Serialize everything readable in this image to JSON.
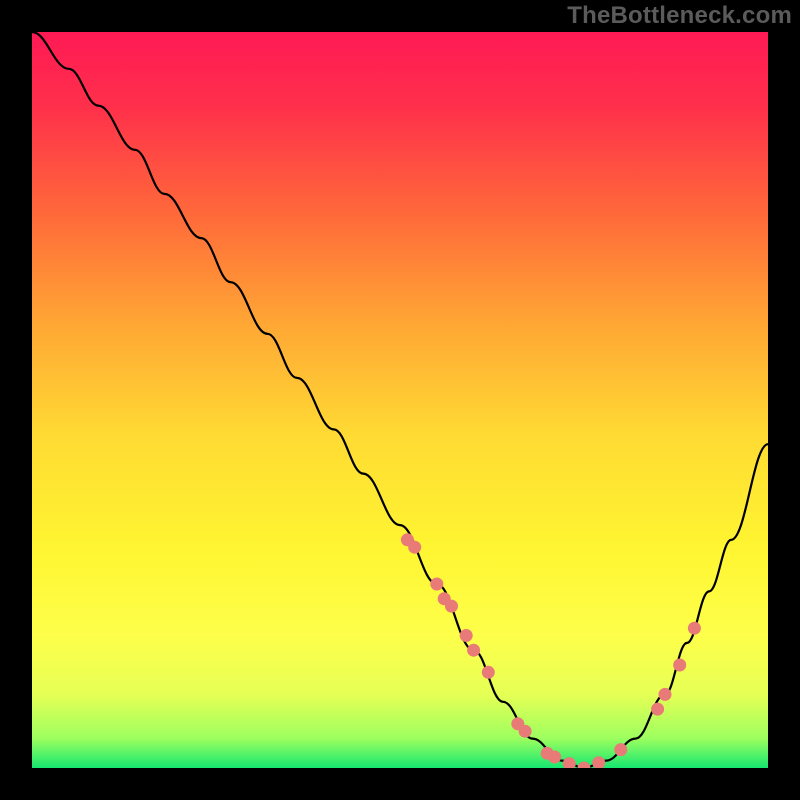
{
  "watermark": "TheBottleneck.com",
  "chart_data": {
    "type": "line",
    "title": "",
    "xlabel": "",
    "ylabel": "",
    "xlim": [
      0,
      100
    ],
    "ylim": [
      0,
      100
    ],
    "grid": false,
    "legend": false,
    "series": [
      {
        "name": "bottleneck-curve",
        "x": [
          0,
          5,
          9,
          14,
          18,
          23,
          27,
          32,
          36,
          41,
          45,
          50,
          55,
          60,
          64,
          68,
          72,
          75,
          78,
          82,
          86,
          89,
          92,
          95,
          100
        ],
        "y": [
          100,
          95,
          90,
          84,
          78,
          72,
          66,
          59,
          53,
          46,
          40,
          33,
          25,
          16,
          9,
          4,
          1,
          0,
          1,
          4,
          10,
          17,
          24,
          31,
          44
        ]
      }
    ],
    "annotations": {
      "markers_x": [
        51,
        52,
        55,
        56,
        57,
        59,
        60,
        62,
        66,
        67,
        70,
        71,
        73,
        75,
        77,
        80,
        85,
        86,
        88,
        90
      ],
      "markers_y": [
        31,
        30,
        25,
        23,
        22,
        18,
        16,
        13,
        6,
        5,
        2,
        1.5,
        0.6,
        0,
        0.7,
        2.5,
        8,
        10,
        14,
        19
      ],
      "marker_color": "#e87a77",
      "line_color": "#000000",
      "background": "red-yellow-green vertical gradient",
      "gradient_stops": [
        {
          "pos": 0.0,
          "color": "#ff1a55"
        },
        {
          "pos": 0.1,
          "color": "#ff2f4b"
        },
        {
          "pos": 0.25,
          "color": "#ff6a3a"
        },
        {
          "pos": 0.4,
          "color": "#ffa834"
        },
        {
          "pos": 0.55,
          "color": "#ffdb33"
        },
        {
          "pos": 0.7,
          "color": "#fff531"
        },
        {
          "pos": 0.82,
          "color": "#fdff4a"
        },
        {
          "pos": 0.9,
          "color": "#e6ff55"
        },
        {
          "pos": 0.96,
          "color": "#9cff5f"
        },
        {
          "pos": 1.0,
          "color": "#16e770"
        }
      ]
    }
  }
}
